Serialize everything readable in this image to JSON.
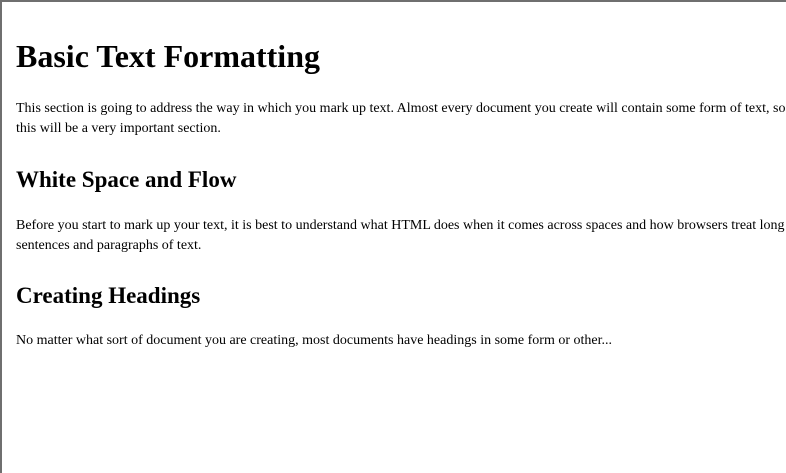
{
  "document": {
    "title": "Basic Text Formatting",
    "intro": "This section is going to address the way in which you mark up text. Almost every document you create will contain some form of text, so this will be a very important section.",
    "sections": [
      {
        "heading": "White Space and Flow",
        "text": "Before you start to mark up your text, it is best to understand what HTML does when it comes across spaces and how browsers treat long sentences and paragraphs of text."
      },
      {
        "heading": "Creating Headings",
        "text": "No matter what sort of document you are creating, most documents have headings in some form or other..."
      }
    ]
  }
}
